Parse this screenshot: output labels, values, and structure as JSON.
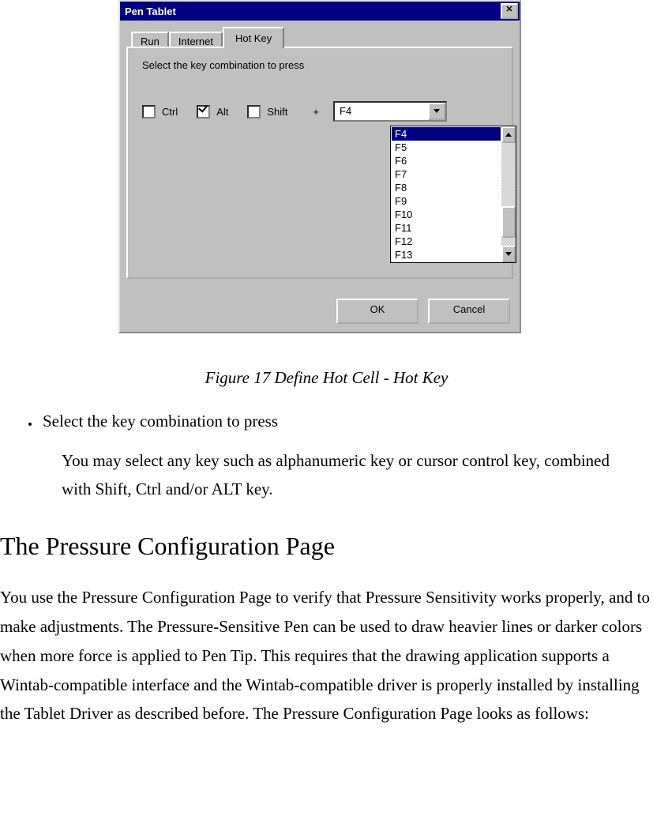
{
  "dialog": {
    "title": "Pen Tablet",
    "tabs": {
      "run": "Run",
      "internet": "Internet",
      "hotkey": "Hot Key"
    },
    "instruction": "Select the key combination to press",
    "checks": {
      "ctrl": "Ctrl",
      "alt": "Alt",
      "shift": "Shift"
    },
    "plus": "+",
    "selected": "F4",
    "options": [
      "F4",
      "F5",
      "F6",
      "F7",
      "F8",
      "F9",
      "F10",
      "F11",
      "F12",
      "F13"
    ],
    "ok": "OK",
    "cancel": "Cancel"
  },
  "doc": {
    "caption": "Figure 17 Define Hot Cell - Hot Key",
    "bullet": "Select the key combination to press",
    "bullet_sub": "You may select any key such as alphanumeric key or cursor control key, combined with Shift, Ctrl and/or ALT key.",
    "heading": "The Pressure Configuration Page",
    "para": "You use the Pressure Configuration Page to verify that Pressure Sensitivity works properly, and to make adjustments. The Pressure-Sensitive Pen can be used to draw heavier lines or darker colors when more force is applied to Pen Tip. This requires that the drawing application supports a Wintab-compatible interface and the Wintab-compatible driver is properly installed by installing the Tablet Driver as described before. The Pressure Configuration Page looks as follows:"
  }
}
